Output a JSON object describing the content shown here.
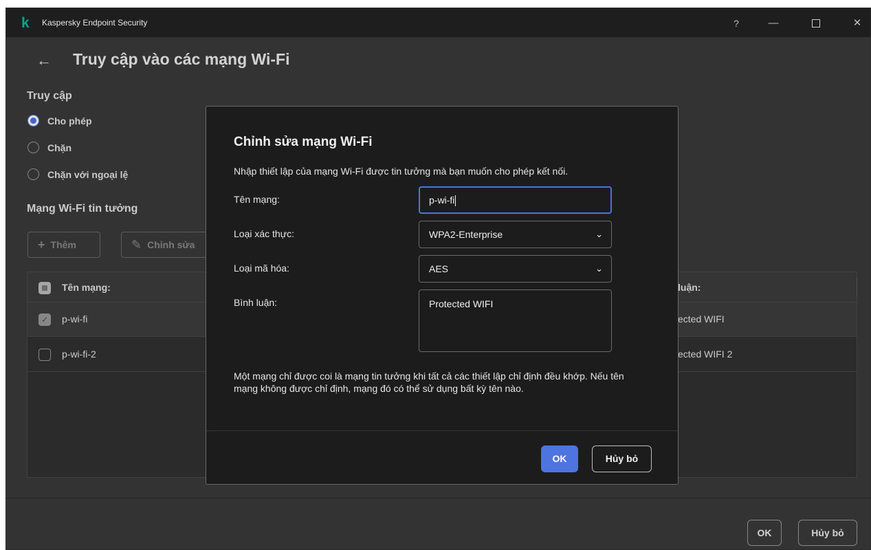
{
  "window": {
    "app_title": "Kaspersky Endpoint Security",
    "help": "?",
    "minimize": "—",
    "close": "✕"
  },
  "page": {
    "title": "Truy cập vào các mạng Wi-Fi",
    "back_icon": "←"
  },
  "access": {
    "label": "Truy cập",
    "options": [
      {
        "label": "Cho phép",
        "selected": true
      },
      {
        "label": "Chặn",
        "selected": false
      },
      {
        "label": "Chặn với ngoại lệ",
        "selected": false
      }
    ]
  },
  "trusted": {
    "label": "Mạng Wi-Fi tin tưởng",
    "add_label": "Thêm",
    "edit_label": "Chỉnh sửa",
    "columns": [
      "Tên mạng:",
      "luận:"
    ],
    "rows": [
      {
        "name": "p-wi-fi",
        "comment": "ected WIFI",
        "checked": true
      },
      {
        "name": "p-wi-fi-2",
        "comment": "ected WIFI 2",
        "checked": false
      }
    ]
  },
  "footer": {
    "ok": "OK",
    "cancel": "Hủy bỏ"
  },
  "dialog": {
    "title": "Chỉnh sửa mạng Wi-Fi",
    "intro": "Nhập thiết lập của mạng Wi-Fi được tin tưởng mà bạn muốn cho phép kết nối.",
    "network_name_label": "Tên mạng:",
    "network_name_value": "p-wi-fi",
    "auth_label": "Loại xác thực:",
    "auth_value": "WPA2-Enterprise",
    "enc_label": "Loại mã hóa:",
    "enc_value": "AES",
    "comment_label": "Bình luận:",
    "comment_value": "Protected WIFI",
    "note": "Một mạng chỉ được coi là mạng tin tưởng khi tất cả các thiết lập chỉ định đều khớp. Nếu tên mạng không được chỉ định, mạng đó có thể sử dụng bất kỳ tên nào.",
    "ok": "OK",
    "cancel": "Hủy bỏ"
  },
  "colors": {
    "accent": "#4e74e0",
    "brand": "#00a88e",
    "background": "#3b3b3b",
    "dialog_bg": "#1c1c1c"
  }
}
